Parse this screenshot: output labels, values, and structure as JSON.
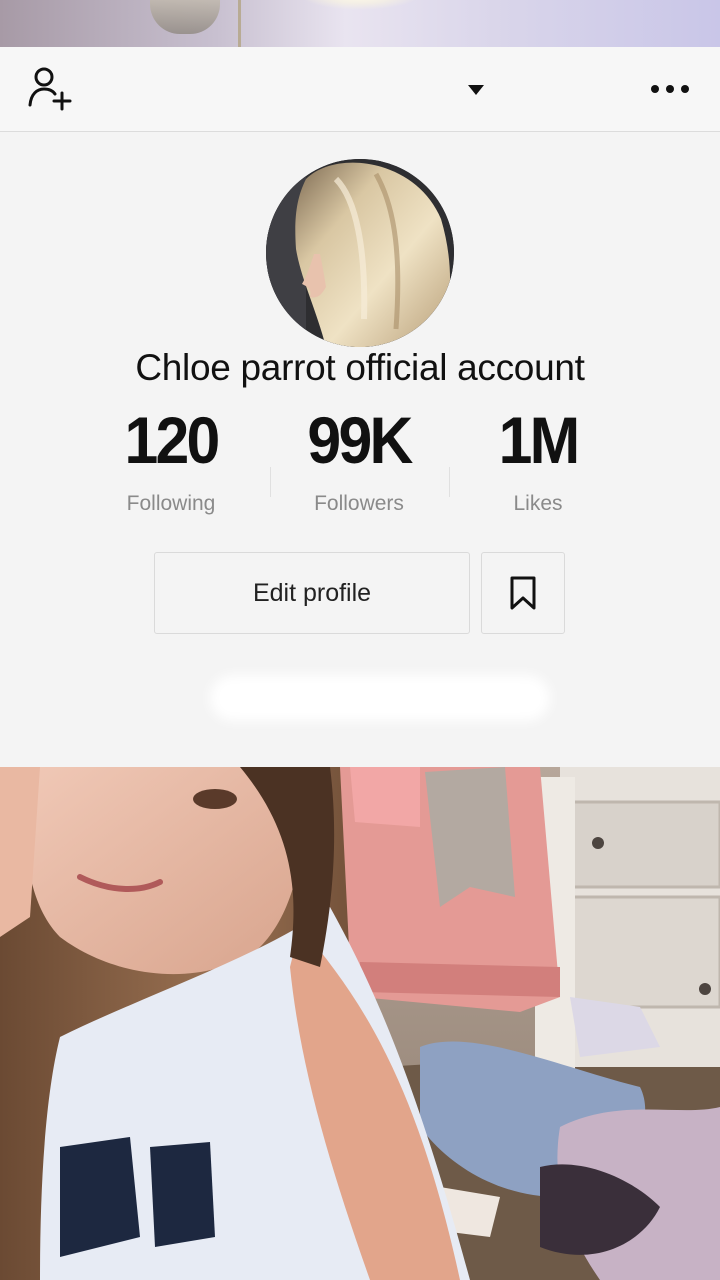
{
  "profile": {
    "display_name": "Chloe parrot official account"
  },
  "stats": [
    {
      "value": "120",
      "label": "Following"
    },
    {
      "value": "99K",
      "label": "Followers"
    },
    {
      "value": "1M",
      "label": "Likes"
    }
  ],
  "actions": {
    "edit_profile_label": "Edit profile"
  },
  "icons": {
    "add_user": "add-user-icon",
    "dropdown": "caret-down-icon",
    "more": "more-options-icon",
    "bookmark": "bookmark-icon"
  },
  "colors": {
    "background": "#f4f4f4",
    "text": "#111111",
    "muted_text": "#8a8a8a",
    "border": "#dadada"
  }
}
